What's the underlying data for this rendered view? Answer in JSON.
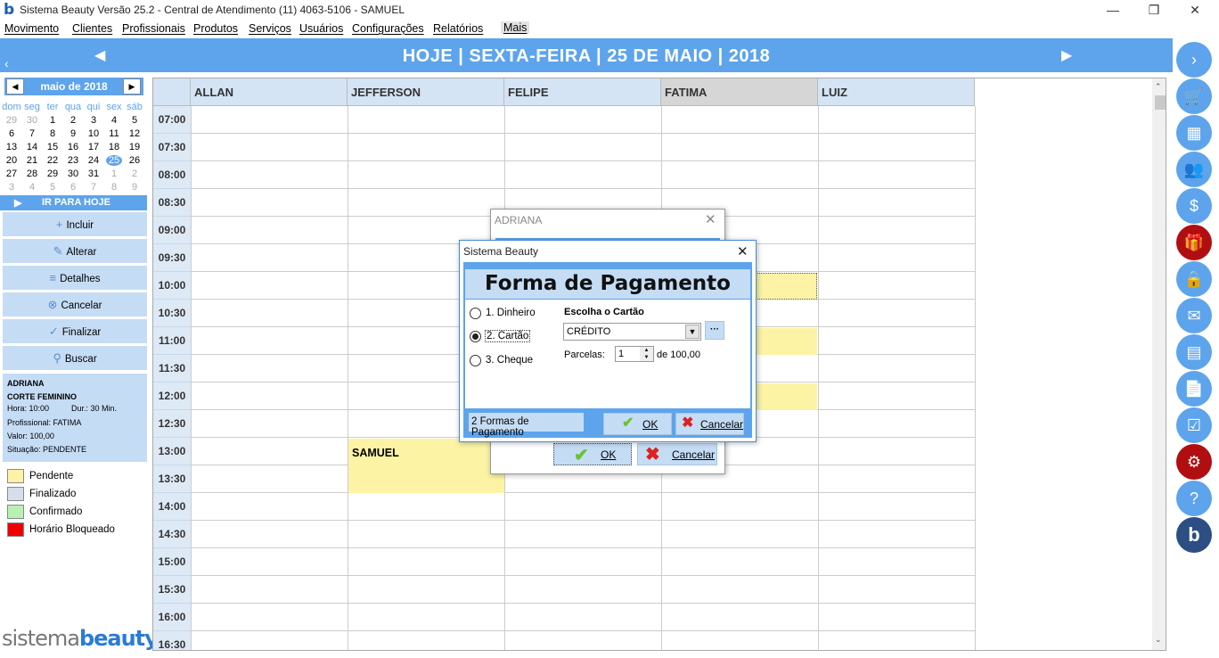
{
  "window": {
    "title": "Sistema Beauty Versão 25.2 - Central de Atendimento (11) 4063-5106 - SAMUEL",
    "minimize": "—",
    "restore": "❐",
    "close": "✕"
  },
  "menu": [
    "Movimento",
    "Clientes",
    "Profissionais",
    "Produtos",
    "Serviços",
    "Usuários",
    "Configurações",
    "Relatórios",
    "Mais"
  ],
  "header": {
    "title": "HOJE | SEXTA-FEIRA | 25 DE MAIO | 2018",
    "prev": "◀",
    "next": "▶",
    "collapse": "‹"
  },
  "calendar": {
    "month": "maio de 2018",
    "prev": "◀",
    "next": "▶",
    "dow": [
      "dom",
      "seg",
      "ter",
      "qua",
      "qui",
      "sex",
      "sáb"
    ],
    "weeks": [
      [
        "29",
        "30",
        "1",
        "2",
        "3",
        "4",
        "5"
      ],
      [
        "6",
        "7",
        "8",
        "9",
        "10",
        "11",
        "12"
      ],
      [
        "13",
        "14",
        "15",
        "16",
        "17",
        "18",
        "19"
      ],
      [
        "20",
        "21",
        "22",
        "23",
        "24",
        "25",
        "26"
      ],
      [
        "27",
        "28",
        "29",
        "30",
        "31",
        "1",
        "2"
      ],
      [
        "3",
        "4",
        "5",
        "6",
        "7",
        "8",
        "9"
      ]
    ],
    "today": "25"
  },
  "ir_para_hoje": "IR PARA HOJE",
  "actions": [
    {
      "label": "Incluir",
      "icon": "+"
    },
    {
      "label": "Alterar",
      "icon": "✎"
    },
    {
      "label": "Detalhes",
      "icon": "≡"
    },
    {
      "label": "Cancelar",
      "icon": "⊗"
    },
    {
      "label": "Finalizar",
      "icon": "✓"
    },
    {
      "label": "Buscar",
      "icon": "⚲"
    }
  ],
  "info": {
    "client": "ADRIANA",
    "service": "CORTE FEMININO",
    "hora": "Hora: 10:00",
    "dur": "Dur.: 30 Min.",
    "prof": "Profissional: FATIMA",
    "valor": "Valor: 100,00",
    "situacao": "Situação: PENDENTE"
  },
  "legend": [
    {
      "label": "Pendente",
      "color": "#fcf3a5"
    },
    {
      "label": "Finalizado",
      "color": "#d6deec"
    },
    {
      "label": "Confirmado",
      "color": "#b9f0b4"
    },
    {
      "label": "Horário Bloqueado",
      "color": "#f00000"
    }
  ],
  "brand": {
    "a": "sistema",
    "b": "beauty"
  },
  "columns": [
    "ALLAN",
    "JEFFERSON",
    "FELIPE",
    "FATIMA",
    "LUIZ"
  ],
  "times": [
    "07:00",
    "07:30",
    "08:00",
    "08:30",
    "09:00",
    "09:30",
    "10:00",
    "10:30",
    "11:00",
    "11:30",
    "12:00",
    "12:30",
    "13:00",
    "13:30",
    "14:00",
    "14:30",
    "15:00",
    "15:30",
    "16:00",
    "16:30"
  ],
  "appointment": {
    "name": "SAMUEL"
  },
  "back_dialog": {
    "title": "ADRIANA",
    "ok": "OK",
    "cancel": "Cancelar"
  },
  "dialog": {
    "title": "Sistema Beauty",
    "heading": "Forma de Pagamento",
    "options": [
      "1. Dinheiro",
      "2. Cartão",
      "3. Cheque"
    ],
    "card_label": "Escolha o Cartão",
    "card_value": "CRÉDITO",
    "more": "···",
    "parcelas_label": "Parcelas:",
    "parcelas_value": "1",
    "de": "de 100,00",
    "formas": "2 Formas de Pagamento",
    "ok": "OK",
    "cancel": "Cancelar"
  }
}
